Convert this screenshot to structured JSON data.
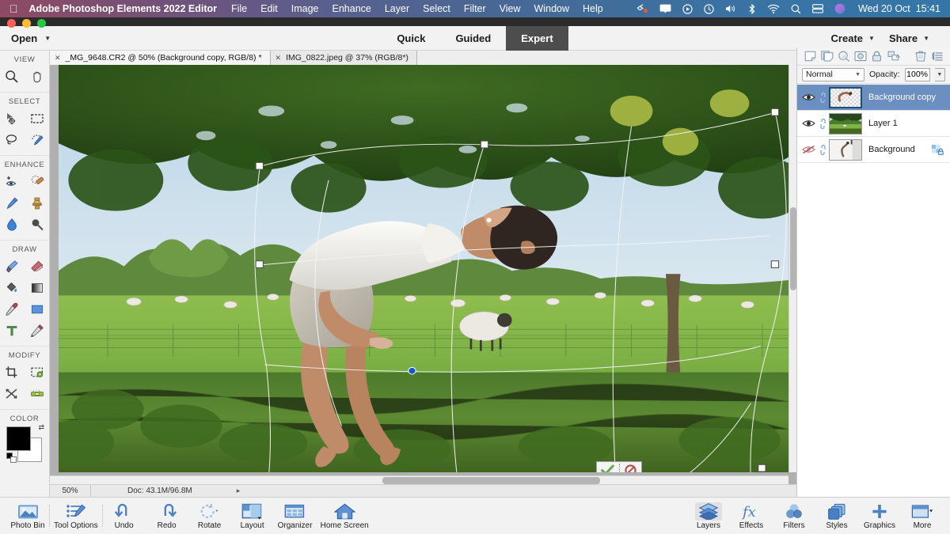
{
  "macbar": {
    "apple_icon": "apple-logo-icon",
    "app_title": "Adobe Photoshop Elements 2022 Editor",
    "menus": [
      "File",
      "Edit",
      "Image",
      "Enhance",
      "Layer",
      "Select",
      "Filter",
      "View",
      "Window",
      "Help"
    ],
    "status_icons": [
      "dropbox-icon",
      "airplay-icon",
      "play-circle-icon",
      "clock-icon",
      "volume-icon",
      "bluetooth-icon",
      "wifi-icon",
      "spotlight-search-icon",
      "display-icon",
      "siri-icon"
    ],
    "clock": "Wed 20 Oct  15:41",
    "gradient_start": "#8e4a63",
    "gradient_end": "#3576a8"
  },
  "window": {
    "traffic_lights": [
      "close-button",
      "minimize-button",
      "maximize-button"
    ]
  },
  "openbar": {
    "open_label": "Open",
    "open_caret": "chevron-down-icon",
    "modes": [
      {
        "label": "Quick",
        "active": false
      },
      {
        "label": "Guided",
        "active": false
      },
      {
        "label": "Expert",
        "active": true
      }
    ],
    "create_label": "Create",
    "share_label": "Share"
  },
  "toolpanel": {
    "groups": [
      {
        "title": "VIEW",
        "tools": [
          {
            "name": "zoom-tool",
            "icon": "magnifier-icon"
          },
          {
            "name": "hand-tool",
            "icon": "hand-icon"
          }
        ]
      },
      {
        "title": "SELECT",
        "tools": [
          {
            "name": "move-tool",
            "icon": "move-arrow-icon"
          },
          {
            "name": "rectangular-marquee-tool",
            "icon": "marquee-dashed-rect-icon"
          },
          {
            "name": "lasso-tool",
            "icon": "lasso-icon"
          },
          {
            "name": "quick-selection-tool",
            "icon": "quick-select-brush-icon"
          }
        ]
      },
      {
        "title": "ENHANCE",
        "tools": [
          {
            "name": "red-eye-removal-tool",
            "icon": "eye-plus-icon"
          },
          {
            "name": "spot-healing-brush-tool",
            "icon": "healing-bandage-icon"
          },
          {
            "name": "smart-brush-tool",
            "icon": "smart-brush-icon"
          },
          {
            "name": "clone-stamp-tool",
            "icon": "clone-stamp-icon"
          },
          {
            "name": "blur-tool",
            "icon": "water-drop-icon"
          },
          {
            "name": "dodge-tool",
            "icon": "dodge-burn-icon"
          }
        ]
      },
      {
        "title": "DRAW",
        "tools": [
          {
            "name": "brush-tool",
            "icon": "paintbrush-icon"
          },
          {
            "name": "eraser-tool",
            "icon": "eraser-icon"
          },
          {
            "name": "paint-bucket-tool",
            "icon": "paint-bucket-icon"
          },
          {
            "name": "gradient-tool",
            "icon": "gradient-icon"
          },
          {
            "name": "color-picker-tool",
            "icon": "eyedropper-icon"
          },
          {
            "name": "shape-tool",
            "icon": "rectangle-shape-icon"
          },
          {
            "name": "type-tool",
            "icon": "type-t-icon"
          },
          {
            "name": "pencil-tool",
            "icon": "pencil-icon"
          }
        ]
      },
      {
        "title": "MODIFY",
        "tools": [
          {
            "name": "crop-tool",
            "icon": "crop-icon"
          },
          {
            "name": "recompose-tool",
            "icon": "recompose-icon"
          },
          {
            "name": "content-aware-move-tool",
            "icon": "content-aware-move-icon"
          },
          {
            "name": "straighten-tool",
            "icon": "straighten-level-icon"
          }
        ]
      }
    ],
    "color_title": "COLOR",
    "foreground_color": "#000000",
    "background_color": "#ffffff",
    "swap_icon": "swap-colors-icon",
    "default_colors_icon": "default-colors-icon"
  },
  "tabs": [
    {
      "label": "_MG_9648.CR2 @ 50% (Background copy, RGB/8) *",
      "active": true,
      "close_icon": "close-icon"
    },
    {
      "label": "IMG_0822.jpeg @ 37% (RGB/8*)",
      "active": false,
      "close_icon": "close-icon"
    }
  ],
  "canvas": {
    "commit_widget": {
      "confirm_icon": "checkmark-icon",
      "confirm_color": "#6aa84f",
      "cancel_icon": "cancel-prohibited-icon",
      "cancel_color": "#b2504a"
    },
    "transform_handles": 8,
    "description": "Photo of a man levitating backwards over a grass field with sheep, framed by green tree foliage"
  },
  "statusbar": {
    "zoom": "50%",
    "doc_info": "Doc: 43.1M/96.8M",
    "expand_icon": "chevron-right-icon"
  },
  "layers_panel": {
    "toolbar_icons": [
      {
        "name": "new-layer-icon"
      },
      {
        "name": "duplicate-layer-icon"
      },
      {
        "name": "adjustment-layer-icon"
      },
      {
        "name": "layer-mask-icon"
      },
      {
        "name": "lock-layer-icon"
      },
      {
        "name": "link-layers-icon"
      },
      {
        "name": "delete-layer-icon"
      },
      {
        "name": "panel-menu-icon"
      }
    ],
    "blend_mode": "Normal",
    "blend_caret": "chevron-down-icon",
    "opacity_label": "Opacity:",
    "opacity_value": "100%",
    "opacity_caret": "chevron-down-icon",
    "selected_row_color": "#6a8fc0",
    "layers": [
      {
        "name": "Background copy",
        "visible": true,
        "selected": true,
        "eye_icon": "eye-visible-icon",
        "link_icon": "link-icon",
        "thumb": "transparent-checker",
        "locked": false
      },
      {
        "name": "Layer 1",
        "visible": true,
        "selected": false,
        "eye_icon": "eye-visible-icon",
        "link_icon": "link-icon",
        "thumb": "field-photo",
        "locked": false
      },
      {
        "name": "Background",
        "visible": false,
        "selected": false,
        "eye_icon": "eye-hidden-icon",
        "link_icon": "link-icon",
        "thumb": "studio-photo",
        "locked": true,
        "lock_icon": "lock-partial-icon"
      }
    ]
  },
  "taskbar": {
    "left_items": [
      {
        "label": "Photo Bin",
        "icon": "photo-bin-icon"
      },
      {
        "label": "Tool Options",
        "icon": "tool-options-icon"
      },
      {
        "label": "Undo",
        "icon": "undo-arrow-icon"
      },
      {
        "label": "Redo",
        "icon": "redo-arrow-icon"
      },
      {
        "label": "Rotate",
        "icon": "rotate-icon"
      },
      {
        "label": "Layout",
        "icon": "layout-icon"
      },
      {
        "label": "Organizer",
        "icon": "organizer-grid-icon"
      },
      {
        "label": "Home Screen",
        "icon": "home-icon"
      }
    ],
    "right_items": [
      {
        "label": "Layers",
        "icon": "layers-stack-icon",
        "active": true
      },
      {
        "label": "Effects",
        "icon": "fx-icon",
        "active": false
      },
      {
        "label": "Filters",
        "icon": "filters-circles-icon",
        "active": false
      },
      {
        "label": "Styles",
        "icon": "styles-cards-icon",
        "active": false
      },
      {
        "label": "Graphics",
        "icon": "plus-icon",
        "active": false
      },
      {
        "label": "More",
        "icon": "more-panel-icon",
        "active": false
      }
    ],
    "accent_color": "#4a7fc1"
  }
}
